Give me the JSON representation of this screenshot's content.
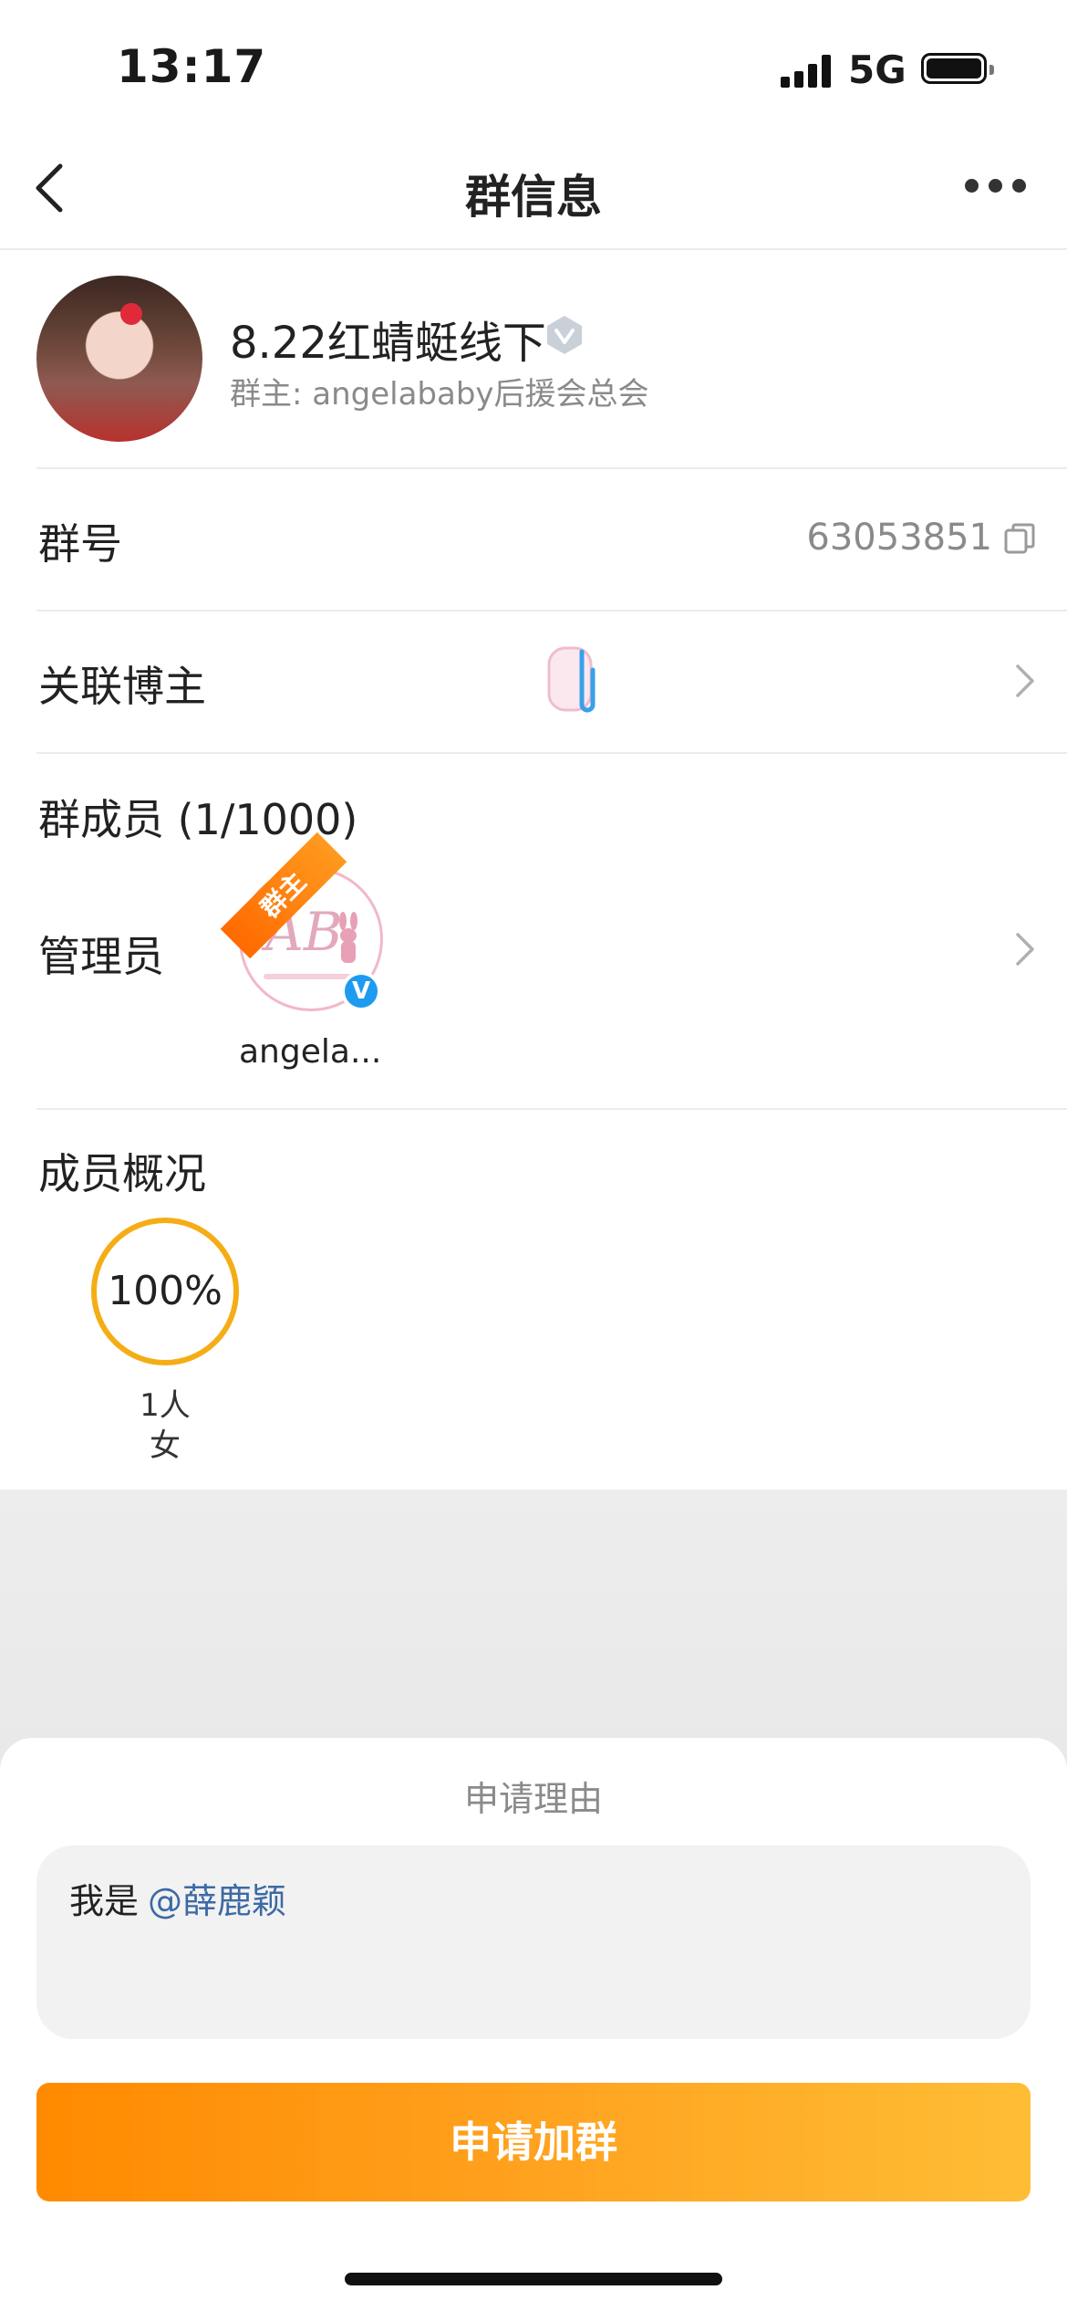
{
  "status_bar": {
    "time": "13:17",
    "network": "5G"
  },
  "nav": {
    "title": "群信息",
    "back_icon": "chevron-left-icon",
    "more_icon": "more-horizontal-icon"
  },
  "group": {
    "name": "8.22红蜻蜓线下",
    "owner_line": "群主: angelababy后援会总会"
  },
  "rows": {
    "group_number_label": "群号",
    "group_number_value": "63053851",
    "linked_blogger_label": "关联博主",
    "members_label": "群成员 (1/1000)",
    "admins_label": "管理员",
    "admin_badge": "群主",
    "admin_verified_glyph": "V",
    "admin_name": "angela...",
    "overview_label": "成员概况"
  },
  "overview": {
    "female_percent_label": "100%",
    "female_percent": 100,
    "count_label": "1人",
    "gender_label": "女"
  },
  "sheet": {
    "title": "申请理由",
    "reason_prefix": "我是",
    "reason_mention": "@薛鹿颖",
    "apply_button": "申请加群"
  },
  "colors": {
    "accent_orange": "#ff8a00",
    "accent_yellow": "#ffbd35",
    "ring": "#f5ad16",
    "mention_blue": "#3c6aa4",
    "verified_blue": "#1d9bf0"
  }
}
